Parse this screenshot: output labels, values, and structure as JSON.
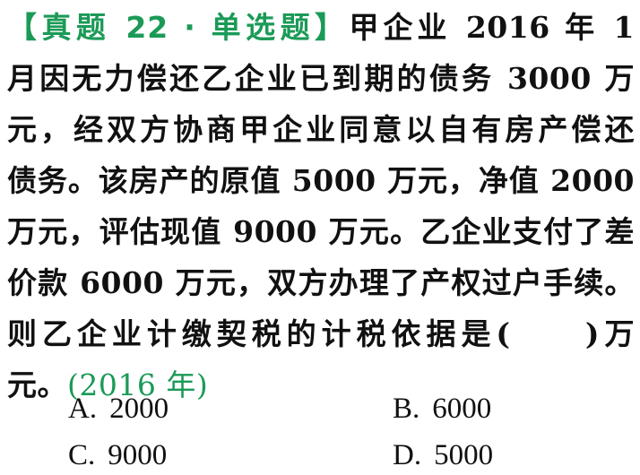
{
  "question": {
    "tag": "【真题 22 · 单选题】",
    "lines": [
      "甲企业 2016 年 1",
      "月因无力偿还乙企业已到期的债务 3000 万",
      "元，经双方协商甲企业同意以自有房产偿还",
      "债务。该房产的原值 5000 万元，净值 2000",
      "万元，评估现值 9000 万元。乙企业支付了差",
      "价款 6000 万元，双方办理了产权过户手续。",
      "则乙企业计缴契税的计税依据是(　　)万",
      "元。"
    ],
    "year_tag": "(2016 年)"
  },
  "options": [
    {
      "letter": "A.",
      "value": "2000"
    },
    {
      "letter": "B.",
      "value": "6000"
    },
    {
      "letter": "C.",
      "value": "9000"
    },
    {
      "letter": "D.",
      "value": "5000"
    }
  ],
  "colors": {
    "accent": "#1b9a57",
    "text": "#111111"
  }
}
